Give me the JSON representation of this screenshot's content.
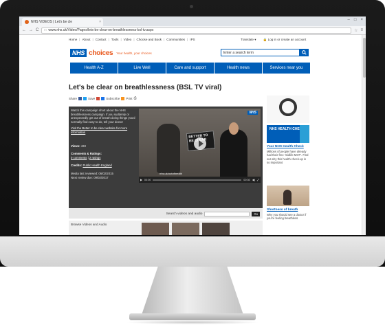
{
  "browser": {
    "tab_title": "NHS VIDEOS | Let's be cle",
    "tab_close": "×",
    "url": "www.nhs.uk/Video/Pages/lets-be-clear-on-breathlessness-bsl-tv.aspx",
    "nav_back": "←",
    "nav_forward": "→",
    "nav_reload": "C"
  },
  "topnav": {
    "items": [
      "Home",
      "About",
      "Contact",
      "Tools",
      "Video",
      "Choose and Book",
      "Communities",
      "IPS"
    ],
    "translate": "Translate ▾",
    "login": "Log in or create an account"
  },
  "logo": {
    "nhs": "NHS",
    "choices": "choices",
    "tagline": "Your health, your choices"
  },
  "search": {
    "placeholder": "Enter a search term"
  },
  "mainnav": [
    "Health A-Z",
    "Live Well",
    "Care and support",
    "Health news",
    "Services near you"
  ],
  "page": {
    "title": "Let's be clear on breathlessness (BSL TV viral)",
    "share": "Share",
    "save": "Save",
    "subscribe": "Subscribe",
    "print": "Print"
  },
  "video": {
    "description": "Watch this campaign short about the NHS breathlessness campaign. If you suddenly or unexpectedly get out of breath doing things you'd normally find easy to do, tell your doctor",
    "link": "Visit the Better to be clear website for more information",
    "views_label": "Views:",
    "views": "433",
    "comments_label": "Comments & Ratings:",
    "comments": "0 comments",
    "ratings": "2 ratings",
    "credits_label": "Credits:",
    "credits": "Public Health England",
    "reviewed": "Media last reviewed: 06/02/2015",
    "next_review": "Next review due: 09/02/2017",
    "sign_text": "BETTER TO BE CLEAR",
    "overlay_url": "nhs.uk/outofbreath",
    "time_start": "00:00",
    "time_end": "00:30",
    "player_badge": "NHS"
  },
  "search_videos": {
    "label": "Search videos and audio",
    "go": "Go"
  },
  "browse": "Browse Videos and Audio",
  "rail": {
    "hc_banner": "NHS HEALTH CHECK",
    "hc_link": "Your NHS Health Check",
    "hc_text": "Millions of people have already had their free 'midlife MOT'. Find out why this health check-up is so important",
    "sb_link": "Shortness of breath",
    "sb_text": "Why you should see a doctor if you're feeling breathless"
  },
  "colors": {
    "nhs_blue": "#005eb8",
    "choices_orange": "#e8561a"
  }
}
